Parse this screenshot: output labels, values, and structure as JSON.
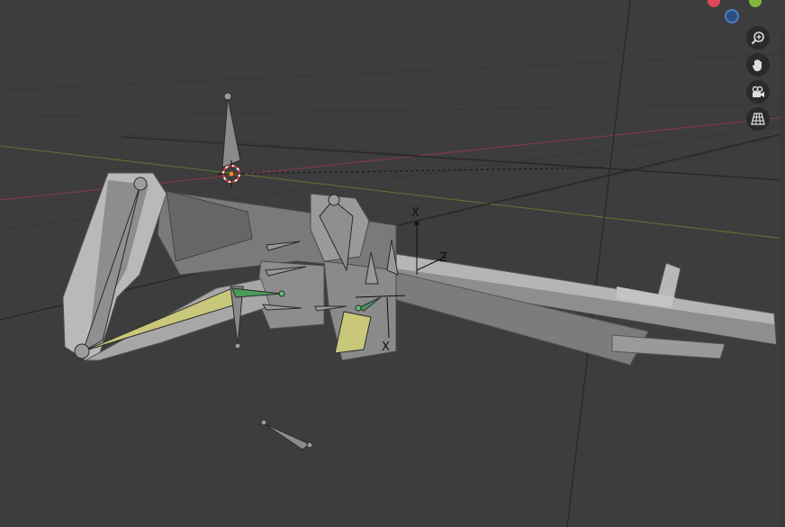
{
  "viewport": {
    "background": "#3d3d3d",
    "grid_line_color": "#353535",
    "x_axis_color": "#8a3b46",
    "y_axis_color": "#5b7a2e",
    "mesh_color": "#a9a9a9",
    "bone_color": "#8c8c8c",
    "selected_bone_color": "#c8c77a",
    "ik_bone_color": "#4a9a5a"
  },
  "gizmo": {
    "x_dot_color": "#e0475a",
    "y_dot_color": "#7fb83a",
    "z_dot_color": "#3c78c8"
  },
  "nav_controls": [
    {
      "name": "zoom-in-icon",
      "label": "zoom"
    },
    {
      "name": "hand-pan-icon",
      "label": "pan"
    },
    {
      "name": "camera-view-icon",
      "label": "camera"
    },
    {
      "name": "perspective-grid-icon",
      "label": "perspective"
    }
  ],
  "empty_labels": {
    "axis_x1": "X",
    "axis_z": "Z",
    "axis_x2": "X"
  }
}
